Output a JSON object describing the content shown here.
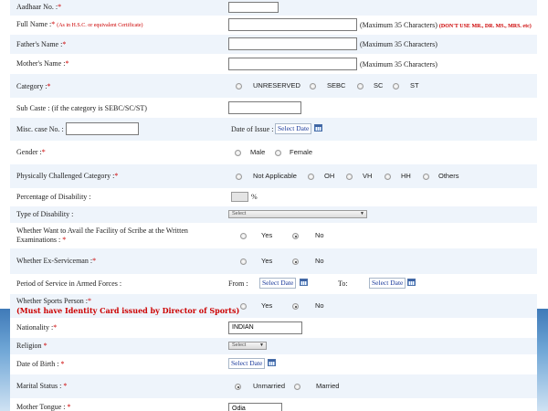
{
  "form": {
    "aadhaar": {
      "label": "Aadhaar No. :",
      "req": "*",
      "value": ""
    },
    "full_name": {
      "label": "Full Name :",
      "req": "*",
      "hint": "(As in H.S.C. or equivalent Certificate)",
      "value": "",
      "note": "(Maximum 35 Characters)",
      "warning": "(DON'T USE MR., DR. MS., MRS. etc)"
    },
    "father_name": {
      "label": "Father's Name :",
      "req": "*",
      "value": "",
      "note": "(Maximum 35 Characters)"
    },
    "mother_name": {
      "label": "Mother's Name :",
      "req": "*",
      "value": "",
      "note": "(Maximum 35 Characters)"
    },
    "category": {
      "label": "Category :",
      "req": "*",
      "options": [
        "UNRESERVED",
        "SEBC",
        "SC",
        "ST"
      ]
    },
    "sub_caste": {
      "label": "Sub Caste : (if the category is SEBC/SC/ST)",
      "value": ""
    },
    "misc_case": {
      "label": "Misc. case No. :",
      "value": "",
      "date_label": "Date of Issue :",
      "date_button": "Select Date"
    },
    "gender": {
      "label": "Gender :",
      "req": "*",
      "options": [
        "Male",
        "Female"
      ]
    },
    "physically_challenged": {
      "label": "Physically Challenged Category :",
      "req": "*",
      "options": [
        "Not Applicable",
        "OH",
        "VH",
        "HH",
        "Others"
      ]
    },
    "disability_pct": {
      "label": "Percentage of Disability :",
      "unit": "%"
    },
    "disability_type": {
      "label": "Type of Disability :",
      "selected": "Select"
    },
    "scribe": {
      "label": "Whether Want to Avail the Facility of Scribe at the Written Examinations :",
      "req": "*",
      "options": [
        "Yes",
        "No"
      ],
      "selected": "No"
    },
    "ex_serviceman": {
      "label": "Whether Ex-Serviceman :",
      "req": "*",
      "options": [
        "Yes",
        "No"
      ],
      "selected": "No"
    },
    "armed_service": {
      "label": "Period of Service in Armed Forces :",
      "from_label": "From :",
      "to_label": "To:",
      "from_button": "Select Date",
      "to_button": "Select Date"
    },
    "sports": {
      "label": "Whether Sports Person :",
      "req": "*",
      "note": "(Must have Identity Card issued by Director of Sports)",
      "options": [
        "Yes",
        "No"
      ],
      "selected": "No"
    },
    "nationality": {
      "label": "Nationality :",
      "req": "*",
      "value": "INDIAN"
    },
    "religion": {
      "label": "Religion",
      "req": "*",
      "selected": "Select"
    },
    "dob": {
      "label": "Date of Birth :",
      "req": "*",
      "date_button": "Select Date"
    },
    "marital": {
      "label": "Marital Status :",
      "req": "*",
      "options": [
        "Unmarried",
        "Married"
      ],
      "selected": "Unmarried"
    },
    "mother_tongue": {
      "label": "Mother Tongue :",
      "req": "*",
      "value": "Odia"
    }
  }
}
